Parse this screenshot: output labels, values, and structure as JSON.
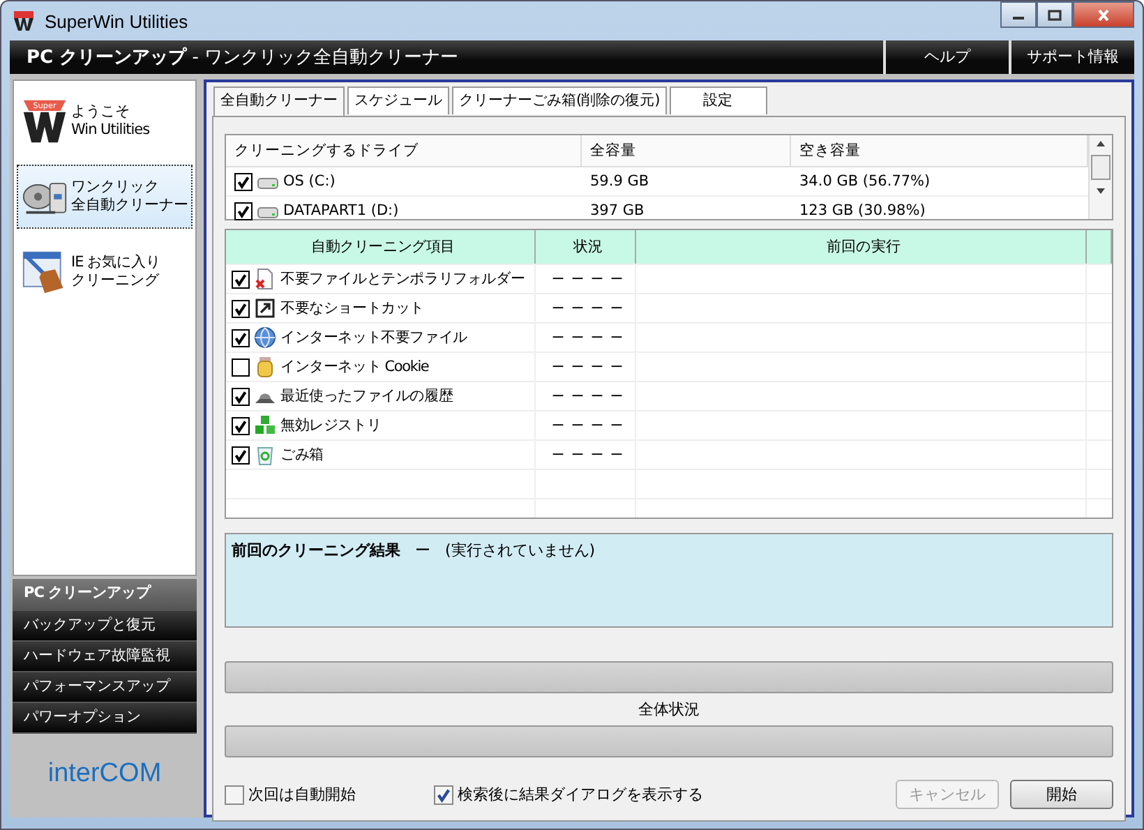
{
  "window": {
    "title": "SuperWin Utilities"
  },
  "header": {
    "title_bold": "PC クリーンアップ",
    "separator": "-",
    "title_rest": "ワンクリック全自動クリーナー",
    "links": [
      "ヘルプ",
      "サポート情報"
    ]
  },
  "sidebar": {
    "items": [
      {
        "kind": "welcome",
        "logo_text": "Super",
        "lines": [
          "ようこそ",
          "Win Utilities"
        ],
        "selected": false
      },
      {
        "kind": "oneclick",
        "lines": [
          "ワンクリック",
          "全自動クリーナー"
        ],
        "selected": true
      },
      {
        "kind": "ie",
        "lines": [
          "IE お気に入り",
          "クリーニング"
        ],
        "selected": false
      }
    ],
    "categories": [
      {
        "label": "PC クリーンアップ",
        "selected": true
      },
      {
        "label": "バックアップと復元",
        "selected": false
      },
      {
        "label": "ハードウェア故障監視",
        "selected": false
      },
      {
        "label": "パフォーマンスアップ",
        "selected": false
      },
      {
        "label": "パワーオプション",
        "selected": false
      }
    ],
    "logo": {
      "text_left": "inter",
      "text_right": "C",
      "text_mid": "O",
      "text_end": "M"
    }
  },
  "tabs": [
    {
      "label": "全自動クリーナー",
      "selected": true
    },
    {
      "label": "スケジュール",
      "selected": false
    },
    {
      "label": "クリーナーごみ箱(削除の復元)",
      "selected": false
    },
    {
      "label": "設定",
      "selected": false
    }
  ],
  "drives": {
    "columns": [
      "クリーニングするドライブ",
      "全容量",
      "空き容量"
    ],
    "rows": [
      {
        "checked": true,
        "name": "OS (C:)",
        "total": "59.9 GB",
        "free": "34.0 GB (56.77%)"
      },
      {
        "checked": true,
        "name": "DATAPART1 (D:)",
        "total": "397 GB",
        "free": "123 GB (30.98%)"
      }
    ]
  },
  "items": {
    "columns": [
      "自動クリーニング項目",
      "状況",
      "前回の実行"
    ],
    "rows": [
      {
        "kind": "file",
        "checked": true,
        "label": "不要ファイルとテンポラリフォルダー",
        "status": "ー ー ー ー"
      },
      {
        "kind": "shortcut",
        "checked": true,
        "label": "不要なショートカット",
        "status": "ー ー ー ー"
      },
      {
        "kind": "globe",
        "checked": true,
        "label": "インターネット不要ファイル",
        "status": "ー ー ー ー"
      },
      {
        "kind": "cookie",
        "checked": false,
        "label": "インターネット Cookie",
        "status": "ー ー ー ー"
      },
      {
        "kind": "history",
        "checked": true,
        "label": "最近使ったファイルの履歴",
        "status": "ー ー ー ー"
      },
      {
        "kind": "registry",
        "checked": true,
        "label": "無効レジストリ",
        "status": "ー ー ー ー"
      },
      {
        "kind": "recycle",
        "checked": true,
        "label": "ごみ箱",
        "status": "ー ー ー ー"
      }
    ]
  },
  "result": {
    "label": "前回のクリーニング結果",
    "dash": "ー",
    "note": "(実行されていません)"
  },
  "progress": [
    {
      "level": 0
    },
    {
      "label": "全体状況",
      "level": 0
    }
  ],
  "options": [
    {
      "label": "次回は自動開始",
      "checked": false
    },
    {
      "label": "検索後に結果ダイアログを表示する",
      "checked": true
    }
  ],
  "buttons": [
    {
      "label": "キャンセル",
      "disabled": true
    },
    {
      "label": "開始",
      "disabled": false
    }
  ]
}
